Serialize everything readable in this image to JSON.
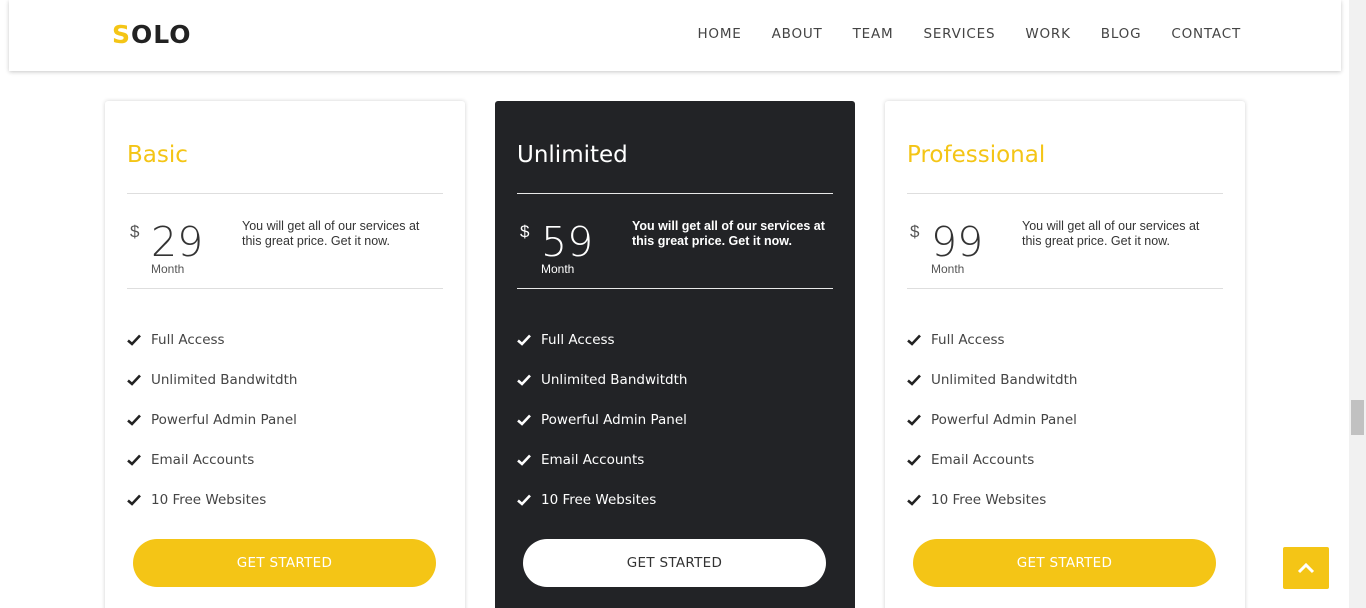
{
  "brand": {
    "logo_first": "S",
    "logo_rest": "OLO",
    "accent_color": "#f4c516"
  },
  "nav": {
    "items": [
      "HOME",
      "ABOUT",
      "TEAM",
      "SERVICES",
      "WORK",
      "BLOG",
      "CONTACT"
    ]
  },
  "plans": [
    {
      "name": "Basic",
      "currency": "$",
      "price": "29",
      "period": "Month",
      "description": "You will get all of our services at this great price. Get it now.",
      "features": [
        "Full Access",
        "Unlimited Bandwitdth",
        "Powerful Admin Panel",
        "Email Accounts",
        "10 Free Websites"
      ],
      "cta": "GET STARTED"
    },
    {
      "name": "Unlimited",
      "currency": "$",
      "price": "59",
      "period": "Month",
      "description": "You will get all of our services at this great price. Get it now.",
      "features": [
        "Full Access",
        "Unlimited Bandwitdth",
        "Powerful Admin Panel",
        "Email Accounts",
        "10 Free Websites"
      ],
      "cta": "GET STARTED"
    },
    {
      "name": "Professional",
      "currency": "$",
      "price": "99",
      "period": "Month",
      "description": "You will get all of our services at this great price. Get it now.",
      "features": [
        "Full Access",
        "Unlimited Bandwitdth",
        "Powerful Admin Panel",
        "Email Accounts",
        "10 Free Websites"
      ],
      "cta": "GET STARTED"
    }
  ],
  "icons": {
    "feature": "check-icon",
    "back_to_top": "chevron-up-icon"
  }
}
